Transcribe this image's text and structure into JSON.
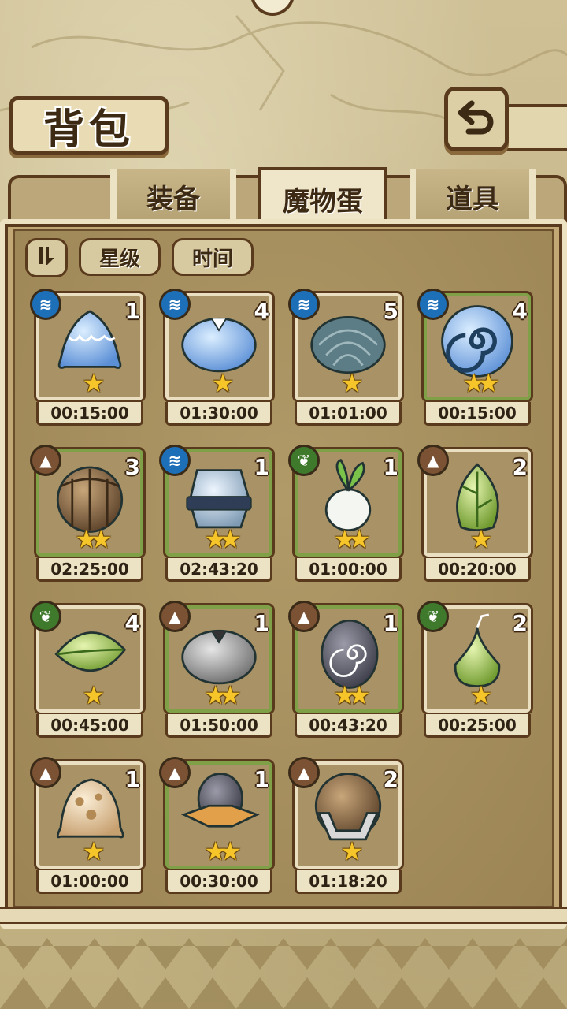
{
  "screen": {
    "title": "背包",
    "back_icon": "return-arrow-icon"
  },
  "tabs": [
    {
      "label": "装备",
      "active": false
    },
    {
      "label": "魔物蛋",
      "active": true
    },
    {
      "label": "道具",
      "active": false
    }
  ],
  "sort": {
    "toggle_label": "⇅",
    "buttons": [
      {
        "label": "星级"
      },
      {
        "label": "时间"
      }
    ]
  },
  "colors": {
    "water": "#1d6fb8",
    "earth": "#7c5234",
    "plant": "#3f7a2c",
    "star": "#f6c52a",
    "rare_frame": "#7fa046"
  },
  "eggs": [
    {
      "element": "water",
      "count": "1",
      "stars": 1,
      "time": "00:15:00",
      "rare": false,
      "icon": "blue-slime-egg"
    },
    {
      "element": "water",
      "count": "4",
      "stars": 1,
      "time": "01:30:00",
      "rare": false,
      "icon": "blue-feather-egg"
    },
    {
      "element": "water",
      "count": "5",
      "stars": 1,
      "time": "01:01:00",
      "rare": false,
      "icon": "shell-egg"
    },
    {
      "element": "water",
      "count": "4",
      "stars": 2,
      "time": "00:15:00",
      "rare": true,
      "icon": "spiral-egg"
    },
    {
      "element": "earth",
      "count": "3",
      "stars": 2,
      "time": "02:25:00",
      "rare": true,
      "icon": "vine-wrapped-egg"
    },
    {
      "element": "water",
      "count": "1",
      "stars": 2,
      "time": "02:43:20",
      "rare": true,
      "icon": "armored-stone-egg"
    },
    {
      "element": "plant",
      "count": "1",
      "stars": 2,
      "time": "01:00:00",
      "rare": true,
      "icon": "radish-egg"
    },
    {
      "element": "earth",
      "count": "2",
      "stars": 1,
      "time": "00:20:00",
      "rare": false,
      "icon": "leaf-bud-egg"
    },
    {
      "element": "plant",
      "count": "4",
      "stars": 1,
      "time": "00:45:00",
      "rare": false,
      "icon": "leaf-egg"
    },
    {
      "element": "earth",
      "count": "1",
      "stars": 2,
      "time": "01:50:00",
      "rare": true,
      "icon": "gray-feather-egg"
    },
    {
      "element": "earth",
      "count": "1",
      "stars": 2,
      "time": "00:43:20",
      "rare": true,
      "icon": "stitched-spiral-egg"
    },
    {
      "element": "plant",
      "count": "2",
      "stars": 1,
      "time": "00:25:00",
      "rare": false,
      "icon": "bulb-sprout-egg"
    },
    {
      "element": "earth",
      "count": "1",
      "stars": 1,
      "time": "01:00:00",
      "rare": false,
      "icon": "sand-slime-egg"
    },
    {
      "element": "earth",
      "count": "1",
      "stars": 2,
      "time": "00:30:00",
      "rare": true,
      "icon": "hat-egg"
    },
    {
      "element": "earth",
      "count": "2",
      "stars": 1,
      "time": "01:18:20",
      "rare": false,
      "icon": "helmet-egg"
    }
  ]
}
